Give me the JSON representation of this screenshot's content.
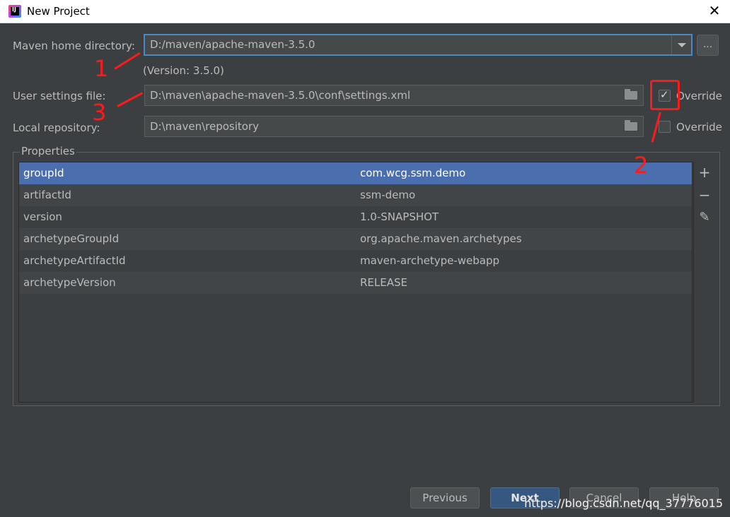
{
  "window": {
    "title": "New Project"
  },
  "maven_home": {
    "label": "Maven home directory:",
    "value": "D:/maven/apache-maven-3.5.0",
    "version_note": "(Version: 3.5.0)",
    "browse_label": "..."
  },
  "user_settings": {
    "label": "User settings file:",
    "value": "D:\\maven\\apache-maven-3.5.0\\conf\\settings.xml",
    "override_label": "Override",
    "override_checked": true
  },
  "local_repo": {
    "label": "Local repository:",
    "value": "D:\\maven\\repository",
    "override_label": "Override",
    "override_checked": false
  },
  "properties": {
    "title": "Properties",
    "rows": [
      {
        "key": "groupId",
        "value": "com.wcg.ssm.demo"
      },
      {
        "key": "artifactId",
        "value": "ssm-demo"
      },
      {
        "key": "version",
        "value": "1.0-SNAPSHOT"
      },
      {
        "key": "archetypeGroupId",
        "value": "org.apache.maven.archetypes"
      },
      {
        "key": "archetypeArtifactId",
        "value": "maven-archetype-webapp"
      },
      {
        "key": "archetypeVersion",
        "value": "RELEASE"
      }
    ],
    "selected_row": 0,
    "tools": {
      "add": "+",
      "remove": "−",
      "edit": "✎"
    }
  },
  "buttons": {
    "previous": "Previous",
    "next": "Next",
    "cancel": "Cancel",
    "help": "Help"
  },
  "annotations": {
    "n1": "1",
    "n2": "2",
    "n3": "3"
  },
  "watermark": "https://blog.csdn.net/qq_37776015",
  "colors": {
    "accent": "#4b6eaf",
    "annotation": "#ff1a1a",
    "background": "#3c3f41"
  }
}
